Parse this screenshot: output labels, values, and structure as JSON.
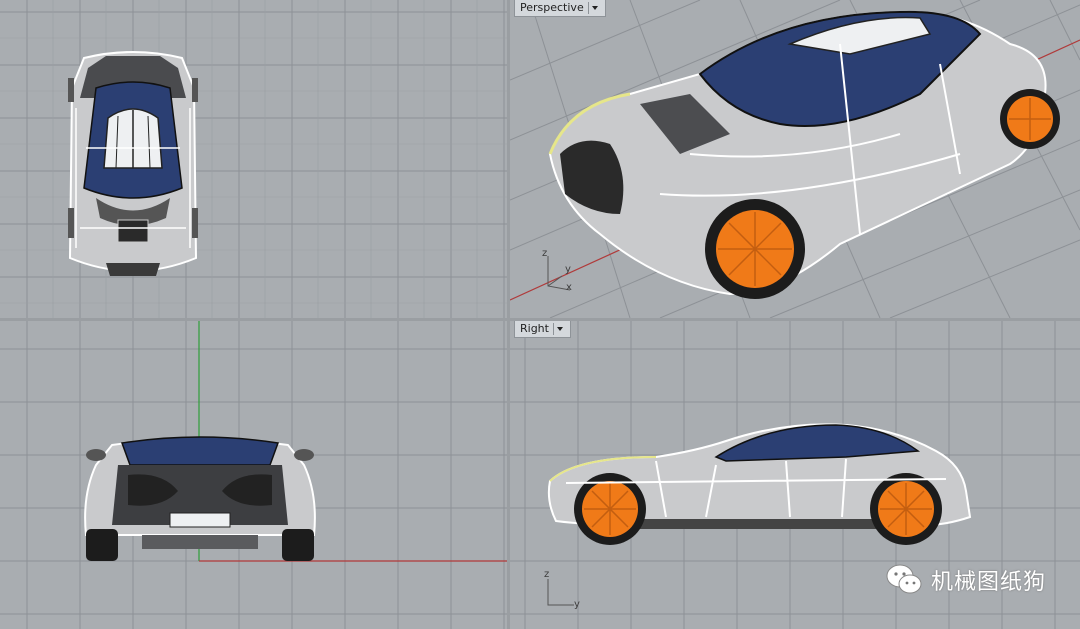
{
  "viewports": {
    "top": {
      "label": ""
    },
    "perspective": {
      "label": "Perspective"
    },
    "front": {
      "label": ""
    },
    "right": {
      "label": "Right"
    }
  },
  "axes": {
    "perspective": {
      "z": "z",
      "y": "y",
      "x": "x"
    },
    "right": {
      "z": "z",
      "y": "y"
    }
  },
  "watermark": {
    "text": "机械图纸狗",
    "icon": "wechat-icon"
  },
  "colors": {
    "viewport_bg": "#a9adb1",
    "grid_line": "#8d9196",
    "car_body": "#c9cacc",
    "car_glass": "#2b3f73",
    "wheel": "#f07a18",
    "x_axis": "#b23a3a",
    "y_axis": "#2f9e3a"
  }
}
